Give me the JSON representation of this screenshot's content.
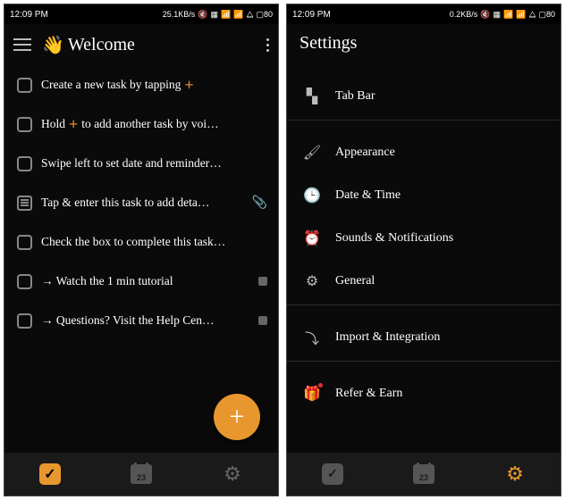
{
  "left": {
    "status": {
      "time": "12:09 PM",
      "net": "25.1KB/s",
      "battery": "80"
    },
    "header": {
      "wave": "👋",
      "title": "Welcome"
    },
    "tasks": [
      {
        "pre": "Create a new task by tapping",
        "plus": "+",
        "post": "",
        "icon": "checkbox"
      },
      {
        "pre": "Hold",
        "plus": "+",
        "post": "to add another task by voi…",
        "icon": "checkbox"
      },
      {
        "pre": "Swipe left to set date and reminder…",
        "plus": "",
        "post": "",
        "icon": "checkbox"
      },
      {
        "pre": "Tap & enter this task to add deta…",
        "plus": "",
        "post": "",
        "icon": "lines",
        "trail": "clip"
      },
      {
        "pre": "Check the box to complete this task…",
        "plus": "",
        "post": "",
        "icon": "checkbox"
      },
      {
        "pre": "→ Watch the 1 min tutorial",
        "plus": "",
        "post": "",
        "icon": "checkbox",
        "trail": "badge"
      },
      {
        "pre": "→ Questions? Visit the Help Cen…",
        "plus": "",
        "post": "",
        "icon": "checkbox",
        "trail": "badge"
      }
    ],
    "nav": {
      "cal_day": "23"
    }
  },
  "right": {
    "status": {
      "time": "12:09 PM",
      "net": "0.2KB/s",
      "battery": "80"
    },
    "header": {
      "title": "Settings"
    },
    "items": [
      {
        "label": "Tab Bar",
        "icon": "grid"
      },
      {
        "label": "Appearance",
        "icon": "paint"
      },
      {
        "label": "Date & Time",
        "icon": "clock"
      },
      {
        "label": "Sounds & Notifications",
        "icon": "alarm"
      },
      {
        "label": "General",
        "icon": "gear"
      },
      {
        "label": "Import & Integration",
        "icon": "import"
      },
      {
        "label": "Refer & Earn",
        "icon": "gift"
      }
    ],
    "nav": {
      "cal_day": "23"
    }
  }
}
